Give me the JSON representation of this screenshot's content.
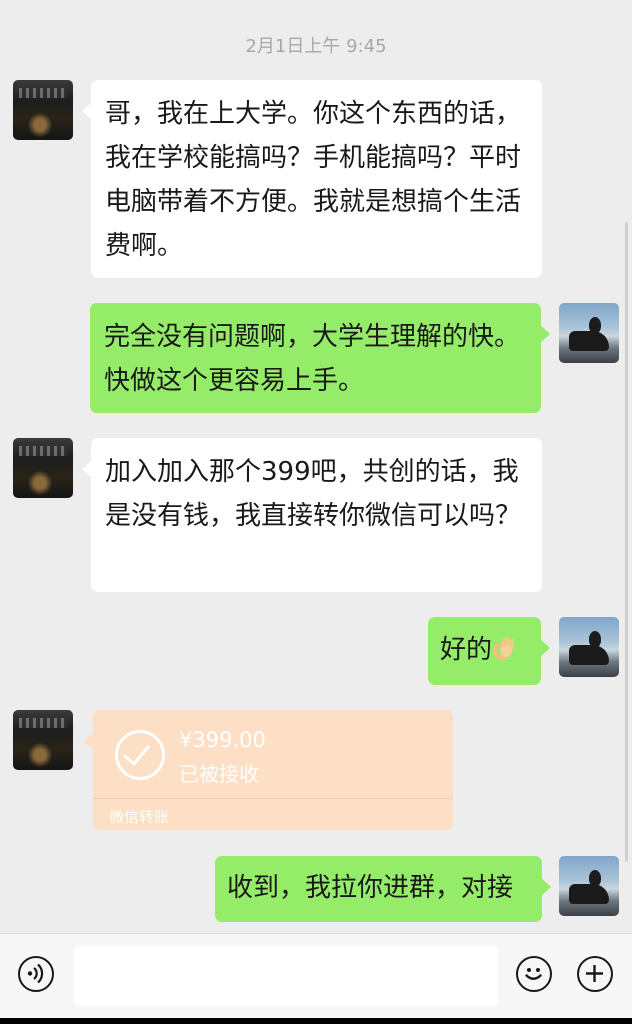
{
  "timestamp": "2月1日上午 9:45",
  "messages": [
    {
      "side": "in",
      "text": "哥，我在上大学。你这个东西的话，我在学校能搞吗？手机能搞吗？平时电脑带着不方便。我就是想搞个生活费啊。"
    },
    {
      "side": "out",
      "text": "完全没有问题啊，大学生理解的快。快做这个更容易上手。"
    },
    {
      "side": "in",
      "text": "加入加入那个399吧，共创的话，我是没有钱，我直接转你微信可以吗？"
    },
    {
      "side": "out",
      "text": "好的"
    },
    {
      "side": "out",
      "text": "收到，我拉你进群，对接"
    }
  ],
  "transfer": {
    "amount": "¥399.00",
    "status": "已被接收",
    "source": "微信转账"
  },
  "ok_emoji_icon": "ok-hand-emoji",
  "toolbar": {
    "voice_icon": "voice-icon",
    "emoji_icon": "emoji-icon",
    "plus_icon": "plus-icon",
    "input_value": ""
  },
  "colors": {
    "background": "#ededed",
    "incoming_bubble": "#ffffff",
    "outgoing_bubble": "#95ec69",
    "transfer_card": "#fcdfc4"
  }
}
